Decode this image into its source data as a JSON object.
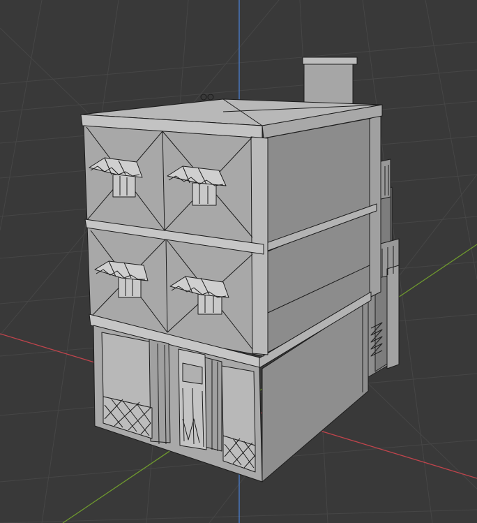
{
  "viewport": {
    "background": "#393939",
    "grid_color": "#464646",
    "axis_x_color": "#c0444c",
    "axis_y_color": "#6f9a2e",
    "axis_z_color": "#4a7fd0"
  },
  "model": {
    "shading": "solid",
    "wireframe_overlay": true,
    "face_light": "#b3b3b3",
    "face_mid": "#9e9e9e",
    "face_dark": "#8c8c8c",
    "edge_color": "#1c1c1c"
  }
}
